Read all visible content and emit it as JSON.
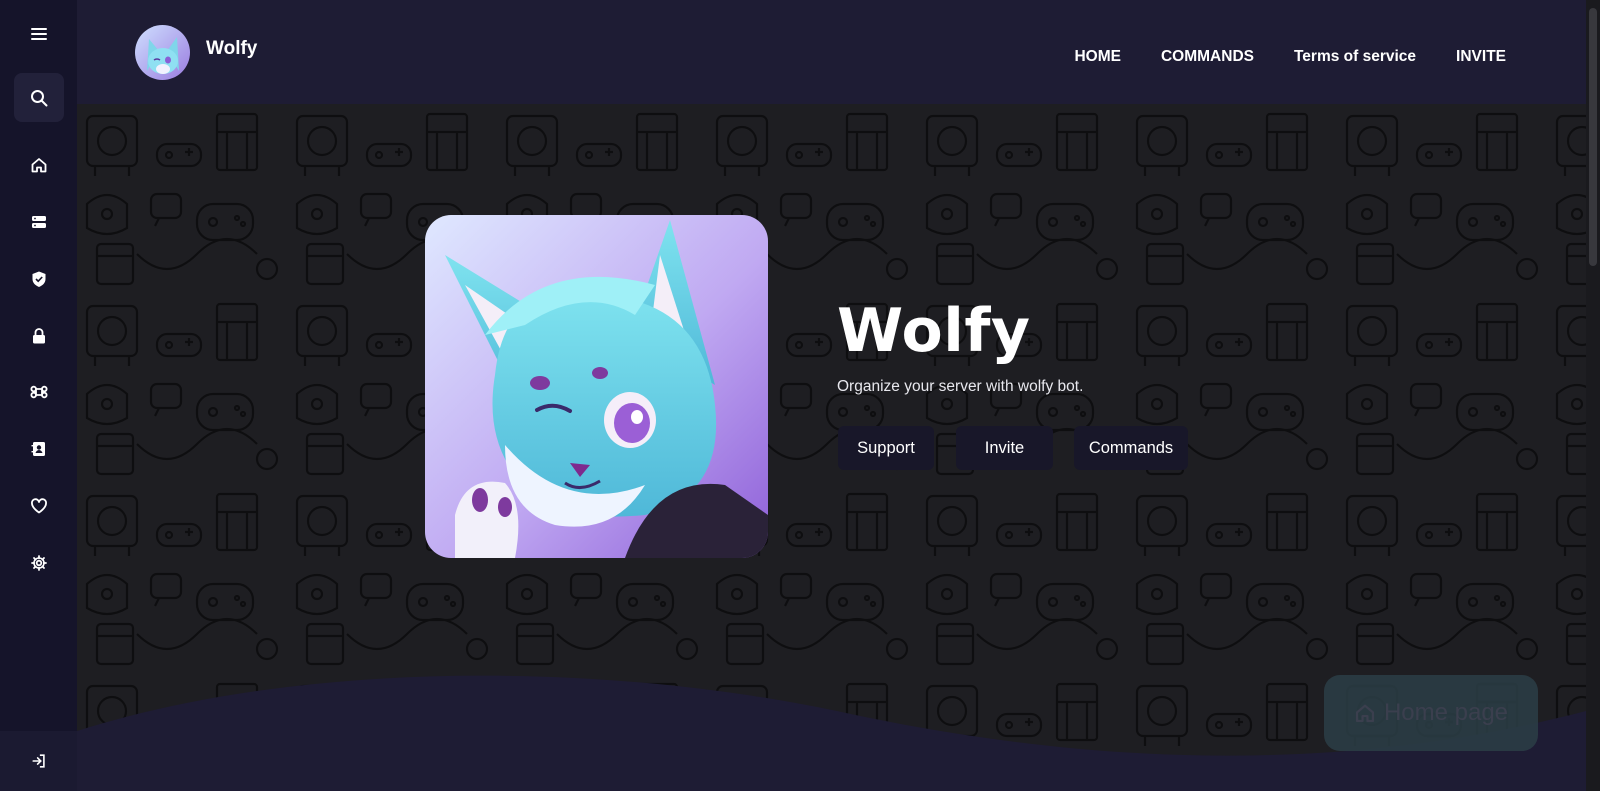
{
  "sidebar": {
    "icons": [
      "menu-icon",
      "search-icon",
      "home-icon",
      "server-icon",
      "shield-icon",
      "lock-icon",
      "command-icon",
      "contact-card-icon",
      "heart-icon",
      "gear-icon",
      "sign-in-icon"
    ]
  },
  "header": {
    "brand": "Wolfy",
    "nav": [
      "HOME",
      "COMMANDS",
      "Terms of service",
      "INVITE"
    ]
  },
  "hero": {
    "title": "Wolfy",
    "subtitle": "Organize your server with wolfy bot.",
    "buttons": [
      "Support",
      "Invite",
      "Commands"
    ]
  },
  "floating": {
    "label": "Home page"
  },
  "colors": {
    "sidebar": "#15142a",
    "topbar": "#1e1c34",
    "background": "#1e1e22",
    "button": "#181729",
    "home_pill": "#2c3e46"
  }
}
